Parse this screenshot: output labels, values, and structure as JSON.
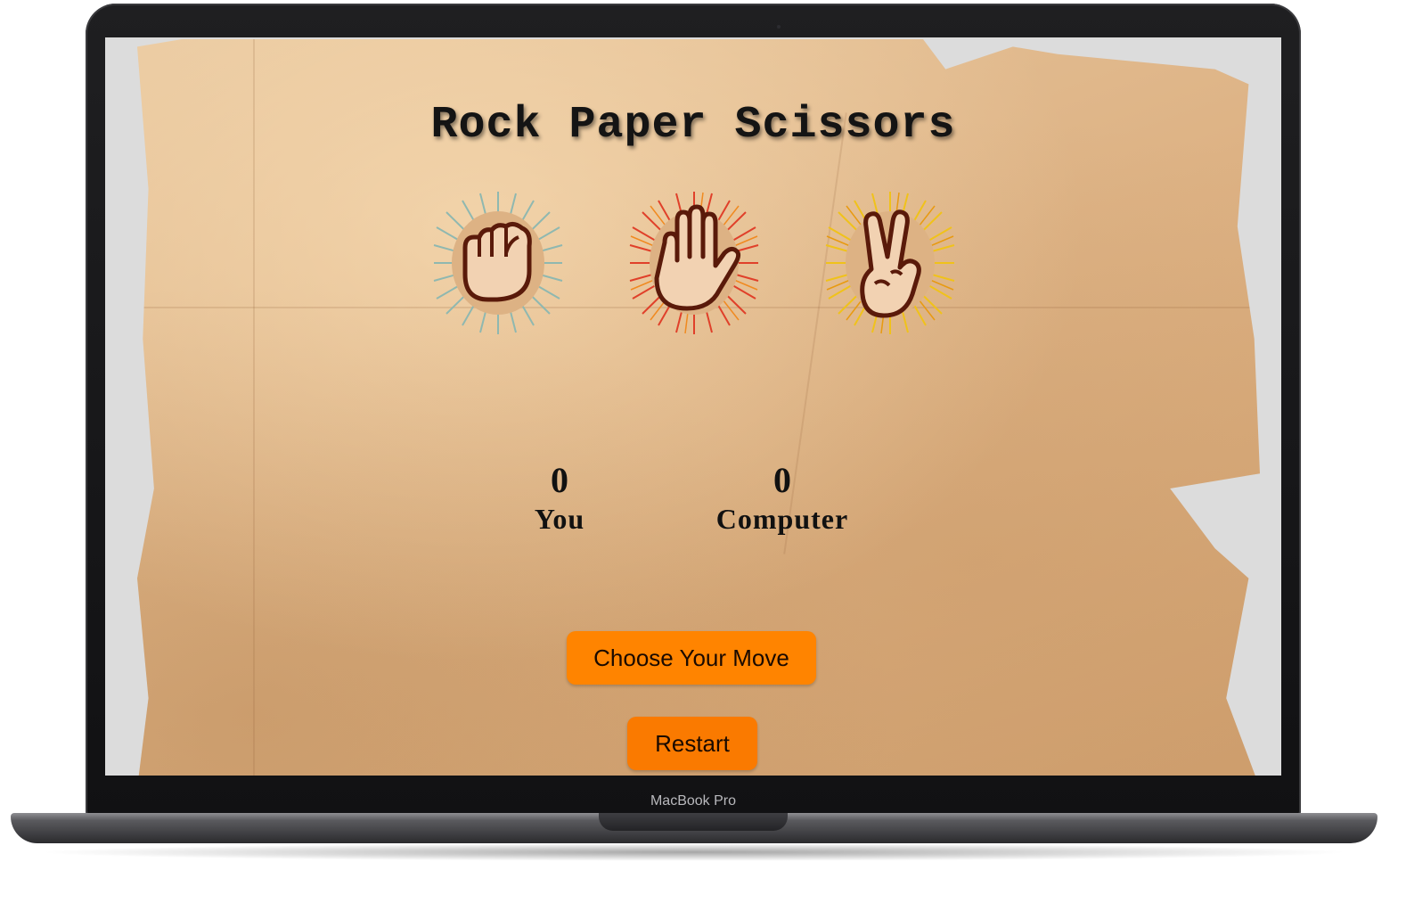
{
  "device": {
    "label": "MacBook Pro"
  },
  "game": {
    "title": "Rock Paper Scissors",
    "choices": [
      {
        "name": "rock",
        "icon": "fist-icon",
        "ray_color": "#8fb8b0"
      },
      {
        "name": "paper",
        "icon": "open-hand-icon",
        "ray_color": "#e0402a"
      },
      {
        "name": "scissors",
        "icon": "peace-hand-icon",
        "ray_color": "#f0c21a"
      }
    ],
    "score": {
      "you": {
        "value": "0",
        "label": "You"
      },
      "computer": {
        "value": "0",
        "label": "Computer"
      }
    },
    "buttons": {
      "choose_move": "Choose Your Move",
      "restart": "Restart"
    }
  },
  "colors": {
    "button": "#ff8400",
    "paper": "#ddb284",
    "ink": "#5a1a0a"
  }
}
